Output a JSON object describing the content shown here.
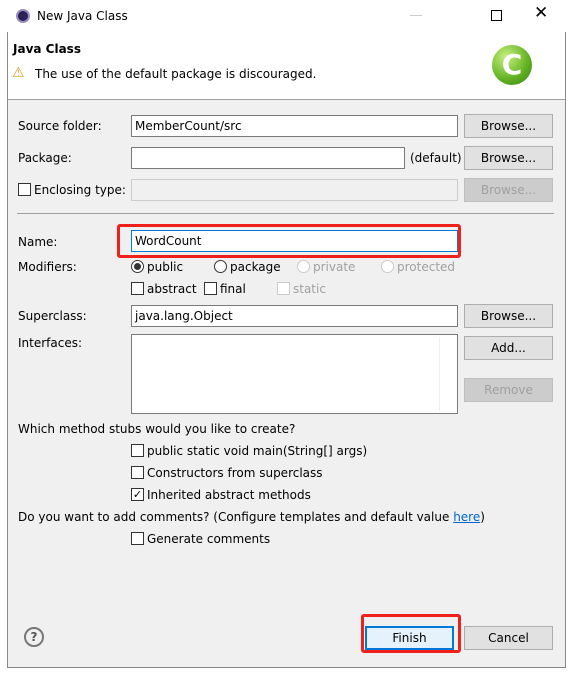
{
  "window": {
    "title": "New Java Class"
  },
  "header": {
    "title": "Java Class",
    "message": "The use of the default package is discouraged."
  },
  "form": {
    "source_folder": {
      "label": "Source folder:",
      "value": "MemberCount/src",
      "browse": "Browse..."
    },
    "package": {
      "label": "Package:",
      "value": "",
      "hint": "(default)",
      "browse": "Browse..."
    },
    "enclosing": {
      "label": "Enclosing type:",
      "checked": false,
      "value": "",
      "browse": "Browse..."
    },
    "name": {
      "label": "Name:",
      "value": "WordCount"
    },
    "modifiers": {
      "label": "Modifiers:",
      "radios": [
        {
          "label": "public",
          "selected": true,
          "enabled": true
        },
        {
          "label": "package",
          "selected": false,
          "enabled": true
        },
        {
          "label": "private",
          "selected": false,
          "enabled": false
        },
        {
          "label": "protected",
          "selected": false,
          "enabled": false
        }
      ],
      "checks": [
        {
          "label": "abstract",
          "checked": false,
          "enabled": true
        },
        {
          "label": "final",
          "checked": false,
          "enabled": true
        },
        {
          "label": "static",
          "checked": false,
          "enabled": false
        }
      ]
    },
    "superclass": {
      "label": "Superclass:",
      "value": "java.lang.Object",
      "browse": "Browse..."
    },
    "interfaces": {
      "label": "Interfaces:",
      "items": [],
      "add": "Add...",
      "remove": "Remove"
    },
    "stubs": {
      "question": "Which method stubs would you like to create?",
      "options": [
        {
          "label": "public static void main(String[] args)",
          "checked": false
        },
        {
          "label": "Constructors from superclass",
          "checked": false
        },
        {
          "label": "Inherited abstract methods",
          "checked": true
        }
      ]
    },
    "comments": {
      "question": "Do you want to add comments? (Configure templates and default value ",
      "link": "here",
      "close": ")",
      "option": {
        "label": "Generate comments",
        "checked": false
      }
    }
  },
  "footer": {
    "finish": "Finish",
    "cancel": "Cancel"
  },
  "colors": {
    "highlight": "#f0201c",
    "focus": "#0078d7",
    "link": "#0066cc"
  }
}
